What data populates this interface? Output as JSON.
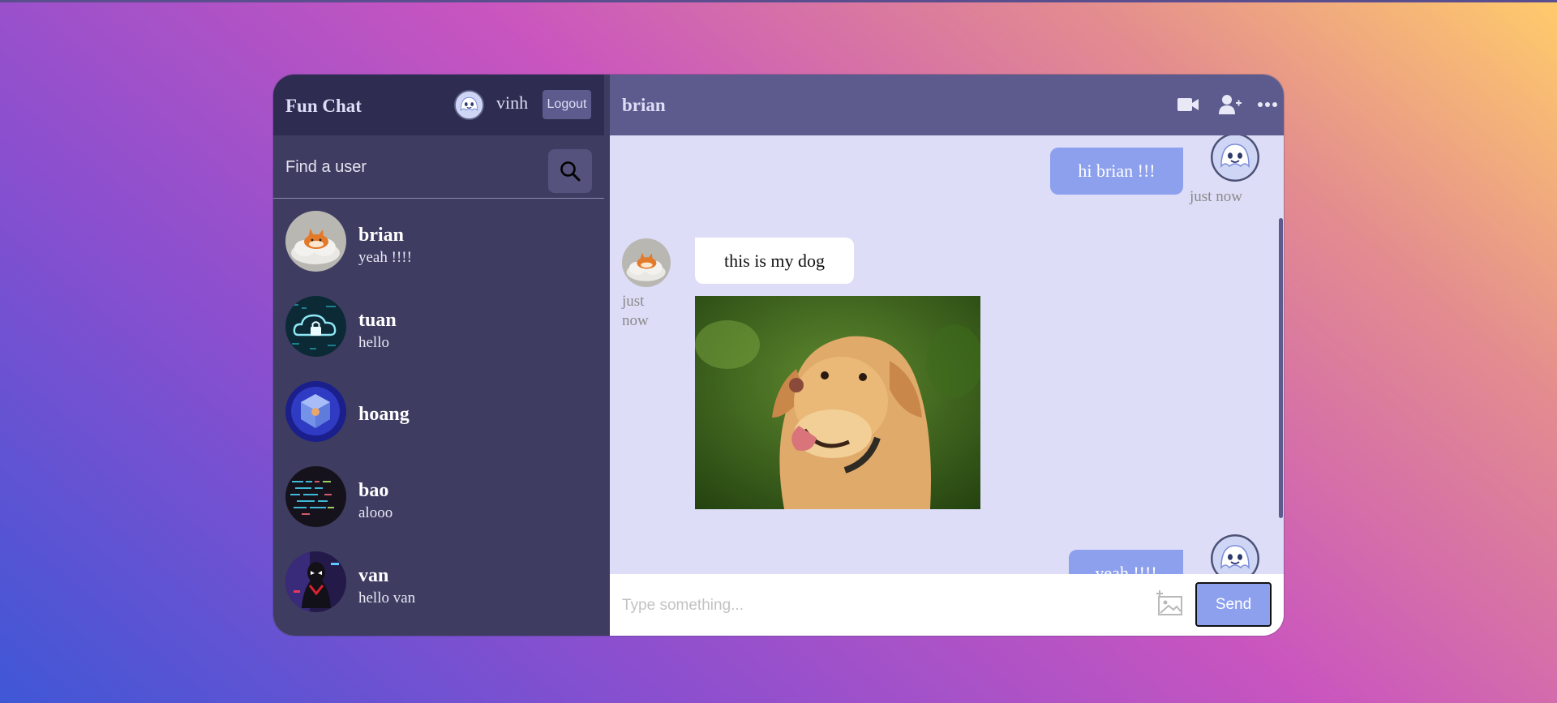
{
  "sidebar": {
    "brand": "Fun Chat",
    "current_user": "vinh",
    "logout_label": "Logout",
    "search_placeholder": "Find a user",
    "users": [
      {
        "name": "brian",
        "last_message": "yeah !!!!"
      },
      {
        "name": "tuan",
        "last_message": "hello"
      },
      {
        "name": "hoang",
        "last_message": ""
      },
      {
        "name": "bao",
        "last_message": "alooo"
      },
      {
        "name": "van",
        "last_message": "hello van"
      }
    ]
  },
  "chat": {
    "title": "brian",
    "header_icons": [
      "video-camera-icon",
      "add-user-icon",
      "more-icon"
    ],
    "messages": [
      {
        "sender": "owner",
        "text": "hi brian !!!",
        "time": "just now"
      },
      {
        "sender": "other",
        "text": "this is my dog",
        "time": "just now",
        "has_image": true
      },
      {
        "sender": "owner",
        "text": "yeah !!!!",
        "time": ""
      }
    ]
  },
  "composer": {
    "placeholder": "Type something...",
    "send_label": "Send"
  },
  "colors": {
    "sidebar": "#3e3c61",
    "sidebar_header": "#2e2c50",
    "chat_header": "#5d5b8d",
    "chat_background": "#ddddf7",
    "owner_bubble": "#8da0ee"
  }
}
